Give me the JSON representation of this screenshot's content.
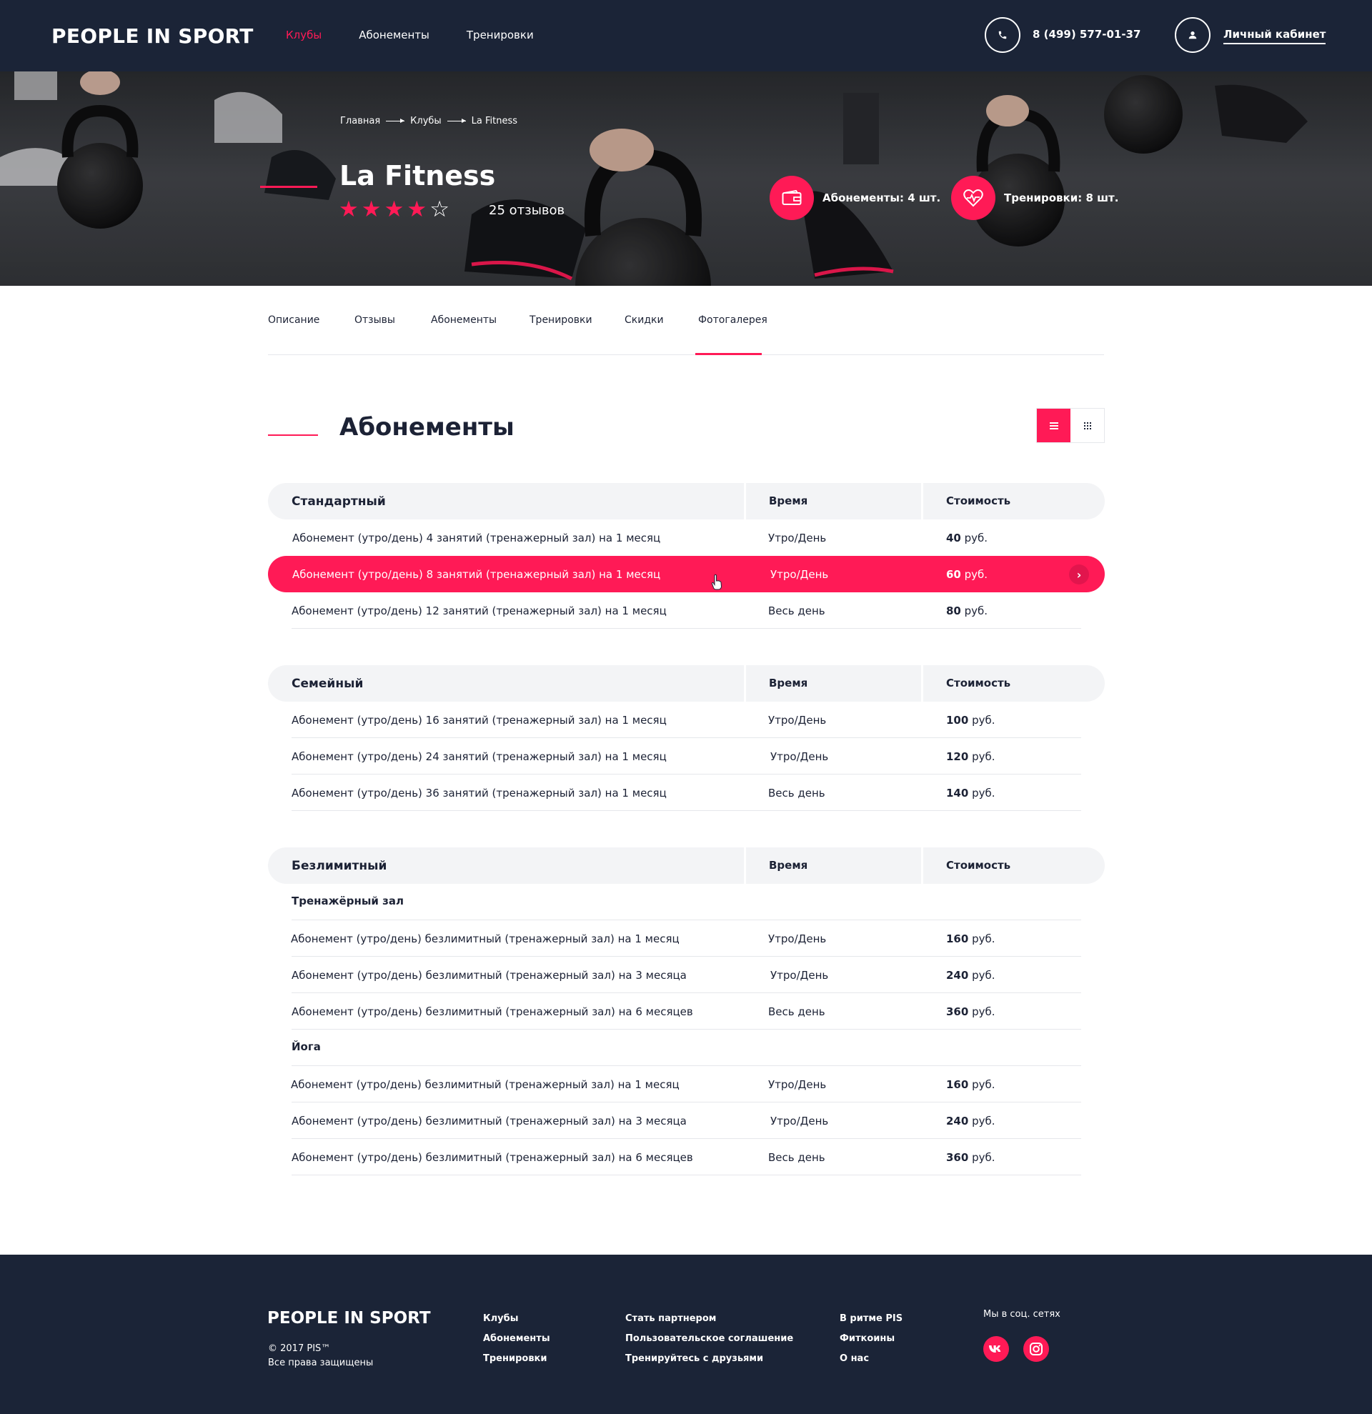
{
  "header": {
    "logo": "PEOPLE IN SPORT",
    "nav": [
      {
        "label": "Клубы",
        "active": true
      },
      {
        "label": "Абонементы",
        "active": false
      },
      {
        "label": "Тренировки",
        "active": false
      }
    ],
    "phone": "8 (499) 577-01-37",
    "cabinet": "Личный кабинет"
  },
  "hero": {
    "breadcrumb": [
      "Главная",
      "Клубы",
      "La Fitness"
    ],
    "club_name": "La Fitness",
    "rating": 4,
    "rating_max": 5,
    "reviews": "25 отзывов",
    "stats": [
      {
        "label": "Абонементы: 4 шт.",
        "icon": "wallet-icon"
      },
      {
        "label": "Тренировки: 8 шт.",
        "icon": "heartbeat-icon"
      }
    ]
  },
  "tabs": [
    {
      "label": "Описание",
      "active": false
    },
    {
      "label": "Отзывы",
      "active": false
    },
    {
      "label": "Абонементы",
      "active": true
    },
    {
      "label": "Тренировки",
      "active": false
    },
    {
      "label": "Скидки",
      "active": false
    },
    {
      "label": "Фотогалерея",
      "active": false
    }
  ],
  "section": {
    "title": "Абонементы",
    "view_modes": [
      "list-view-icon",
      "grid-view-icon"
    ],
    "active_view": "list"
  },
  "groups": [
    {
      "name": "Стандартный",
      "col_time": "Время",
      "col_price": "Стоимость",
      "rows": [
        {
          "name": "Абонемент (утро/день) 4 занятий (тренажерный зал) на 1 месяц",
          "time": "Утро/День",
          "price": "40",
          "currency": "руб."
        },
        {
          "name": "Абонемент (утро/день) 8 занятий (тренажерный зал) на 1 месяц",
          "time": "Утро/День",
          "price": "60",
          "currency": "руб.",
          "highlight": true
        },
        {
          "name": "Абонемент (утро/день) 12 занятий (тренажерный зал) на 1 месяц",
          "time": "Весь день",
          "price": "80",
          "currency": "руб."
        }
      ]
    },
    {
      "name": "Семейный",
      "col_time": "Время",
      "col_price": "Стоимость",
      "rows": [
        {
          "name": "Абонемент (утро/день) 16 занятий (тренажерный зал) на 1 месяц",
          "time": "Утро/День",
          "price": "100",
          "currency": "руб."
        },
        {
          "name": "Абонемент (утро/день) 24 занятий (тренажерный зал) на 1 месяц",
          "time": "Утро/День",
          "price": "120",
          "currency": "руб."
        },
        {
          "name": "Абонемент (утро/день) 36 занятий (тренажерный зал) на 1 месяц",
          "time": "Весь день",
          "price": "140",
          "currency": "руб."
        }
      ]
    },
    {
      "name": "Безлимитный",
      "col_time": "Время",
      "col_price": "Стоимость",
      "subgroups": [
        {
          "name": "Тренажёрный зал",
          "rows": [
            {
              "name": "Абонемент (утро/день) безлимитный (тренажерный зал) на 1 месяц",
              "time": "Утро/День",
              "price": "160",
              "currency": "руб."
            },
            {
              "name": "Абонемент (утро/день) безлимитный (тренажерный зал) на 3 месяца",
              "time": "Утро/День",
              "price": "240",
              "currency": "руб."
            },
            {
              "name": "Абонемент (утро/день) безлимитный (тренажерный зал) на 6 месяцев",
              "time": "Весь день",
              "price": "360",
              "currency": "руб."
            }
          ]
        },
        {
          "name": "Йога",
          "rows": [
            {
              "name": "Абонемент (утро/день) безлимитный (тренажерный зал) на 1 месяц",
              "time": "Утро/День",
              "price": "160",
              "currency": "руб."
            },
            {
              "name": "Абонемент (утро/день) безлимитный (тренажерный зал) на 3 месяца",
              "time": "Утро/День",
              "price": "240",
              "currency": "руб."
            },
            {
              "name": "Абонемент (утро/день) безлимитный (тренажерный зал) на 6 месяцев",
              "time": "Весь день",
              "price": "360",
              "currency": "руб."
            }
          ]
        }
      ]
    }
  ],
  "footer": {
    "logo": "PEOPLE IN SPORT",
    "copyright": "© 2017 PIS™",
    "rights": "Все права защищены",
    "col1": [
      "Клубы",
      "Абонементы",
      "Тренировки"
    ],
    "col2": [
      "Стать партнером",
      "Пользовательское соглашение",
      "Тренируйтесь с друзьями"
    ],
    "col3": [
      "В ритме PIS",
      "Фиткоины",
      "О нас"
    ],
    "social_title": "Мы в соц. сетях",
    "social": [
      "vk-icon",
      "instagram-icon"
    ]
  },
  "colors": {
    "accent": "#ff1a56",
    "dark": "#1b2437",
    "light_row": "#f3f4f6"
  }
}
